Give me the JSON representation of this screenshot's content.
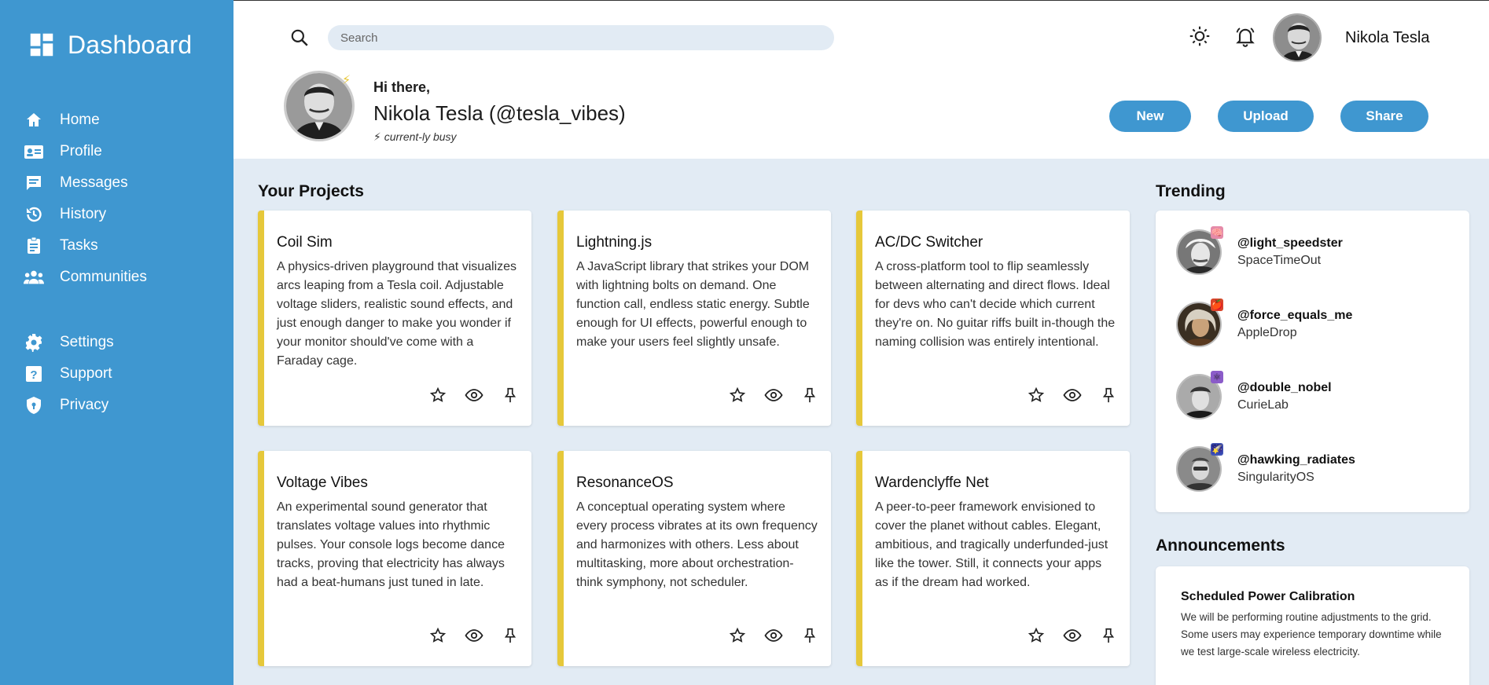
{
  "sidebar": {
    "brand": "Dashboard",
    "items": [
      {
        "label": "Home",
        "icon": "home-icon"
      },
      {
        "label": "Profile",
        "icon": "id-card-icon"
      },
      {
        "label": "Messages",
        "icon": "message-icon"
      },
      {
        "label": "History",
        "icon": "history-icon"
      },
      {
        "label": "Tasks",
        "icon": "clipboard-icon"
      },
      {
        "label": "Communities",
        "icon": "groups-icon"
      }
    ],
    "items2": [
      {
        "label": "Settings",
        "icon": "gear-icon"
      },
      {
        "label": "Support",
        "icon": "help-icon"
      },
      {
        "label": "Privacy",
        "icon": "shield-icon"
      }
    ]
  },
  "header": {
    "search_placeholder": "Search",
    "user_name": "Nikola Tesla",
    "greeting": "Hi there,",
    "full_name": "Nikola Tesla (@tesla_vibes)",
    "status": "⚡ current-ly busy",
    "buttons": {
      "new": "New",
      "upload": "Upload",
      "share": "Share"
    }
  },
  "projects": {
    "title": "Your Projects",
    "items": [
      {
        "name": "Coil Sim",
        "desc": "A physics-driven playground that visualizes arcs leaping from a Tesla coil. Adjustable voltage sliders, realistic sound effects, and just enough danger to make you wonder if your monitor should've come with a Faraday cage."
      },
      {
        "name": "Lightning.js",
        "desc": "A JavaScript library that strikes your DOM with lightning bolts on demand. One function call, endless static energy. Subtle enough for UI effects, powerful enough to make your users feel slightly unsafe."
      },
      {
        "name": "AC/DC Switcher",
        "desc": "A cross-platform tool to flip seamlessly between alternating and direct flows. Ideal for devs who can't decide which current they're on. No guitar riffs built in-though the naming collision was entirely intentional."
      },
      {
        "name": "Voltage Vibes",
        "desc": "An experimental sound generator that translates voltage values into rhythmic pulses. Your console logs become dance tracks, proving that electricity has always had a beat-humans just tuned in late."
      },
      {
        "name": "ResonanceOS",
        "desc": "A conceptual operating system where every process vibrates at its own frequency and harmonizes with others. Less about multitasking, more about orchestration-think symphony, not scheduler."
      },
      {
        "name": "Wardenclyffe Net",
        "desc": "A peer-to-peer framework envisioned to cover the planet without cables. Elegant, ambitious, and tragically underfunded-just like the tower. Still, it connects your apps as if the dream had worked."
      }
    ]
  },
  "trending": {
    "title": "Trending",
    "items": [
      {
        "handle": "@light_speedster",
        "org": "SpaceTimeOut",
        "badge": "🧠",
        "badge_color": "#e58aa8"
      },
      {
        "handle": "@force_equals_me",
        "org": "AppleDrop",
        "badge": "🍎",
        "badge_color": "#d9452b"
      },
      {
        "handle": "@double_nobel",
        "org": "CurieLab",
        "badge": "⚛",
        "badge_color": "#8b5cc9"
      },
      {
        "handle": "@hawking_radiates",
        "org": "SingularityOS",
        "badge": "🌠",
        "badge_color": "#4457b8"
      }
    ]
  },
  "announcements": {
    "title": "Announcements",
    "items": [
      {
        "title": "Scheduled Power Calibration",
        "body": "We will be performing routine adjustments to the grid. Some users may experience temporary downtime while we test large-scale wireless electricity."
      }
    ]
  },
  "colors": {
    "sidebar": "#3f97d0",
    "accent": "#3f97d0",
    "card_border": "#e6c83a",
    "background": "#e2ebf4"
  }
}
